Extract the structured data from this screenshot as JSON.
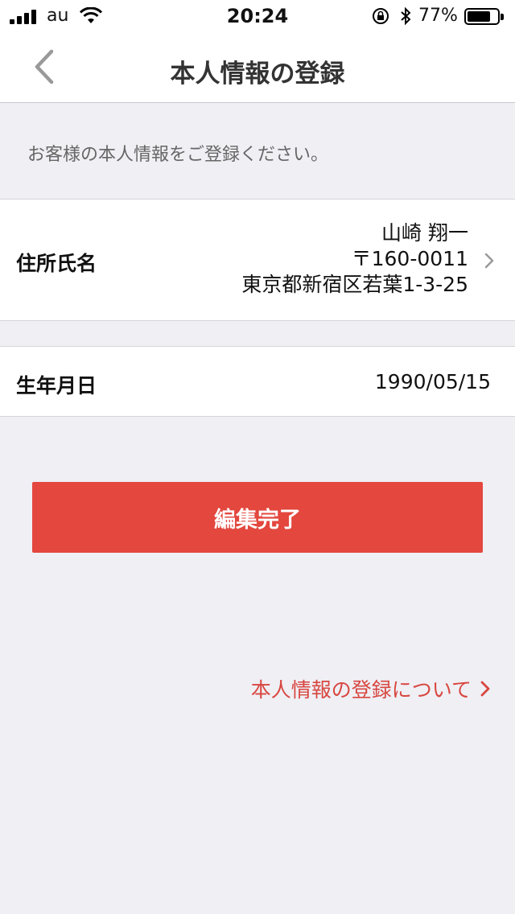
{
  "status_bar": {
    "carrier": "au",
    "time": "20:24",
    "battery_percent": "77%",
    "battery_level": 0.77,
    "icons": [
      "signal-icon",
      "wifi-icon",
      "rotation-lock-icon",
      "bluetooth-icon",
      "battery-icon"
    ]
  },
  "nav": {
    "title": "本人情報の登録",
    "back_icon": "chevron-left-icon"
  },
  "intro_text": "お客様の本人情報をご登録ください。",
  "address_cell": {
    "label": "住所氏名",
    "name": "山崎 翔一",
    "postal": "〒160-0011",
    "address": "東京都新宿区若葉1-3-25"
  },
  "birth_cell": {
    "label": "生年月日",
    "value": "1990/05/15"
  },
  "primary_button": {
    "label": "編集完了"
  },
  "about_link": {
    "label": "本人情報の登録について"
  },
  "colors": {
    "accent": "#e3473e",
    "link": "#d8463f",
    "background": "#efeff4"
  }
}
